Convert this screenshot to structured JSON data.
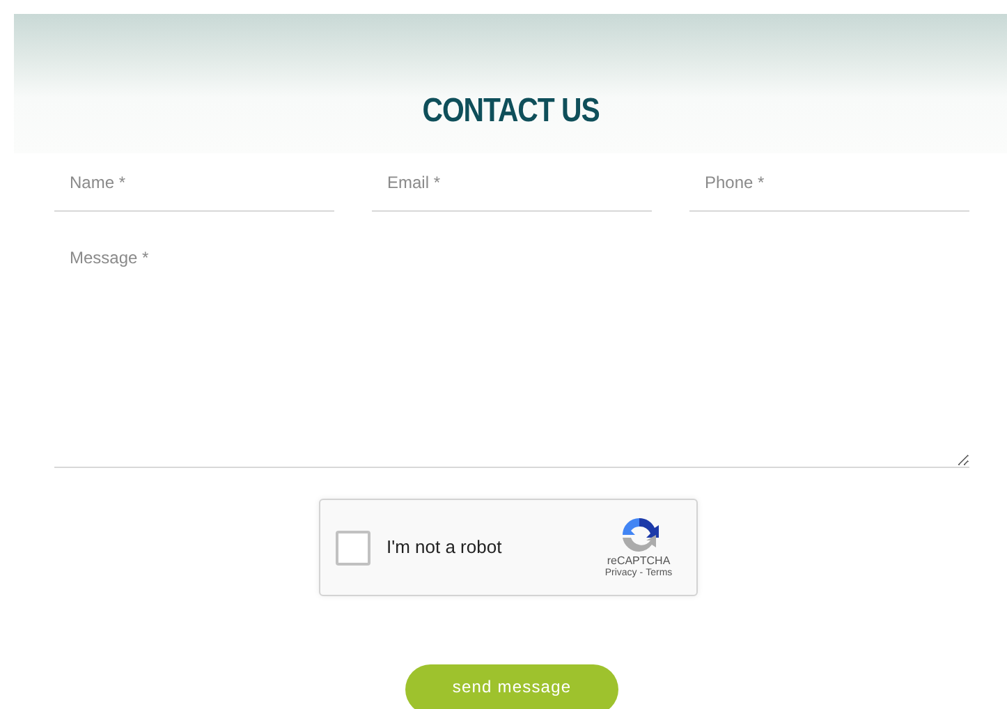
{
  "heading": "CONTACT US",
  "fields": [
    {
      "placeholder": "Name *"
    },
    {
      "placeholder": "Email *"
    },
    {
      "placeholder": "Phone *"
    }
  ],
  "message": {
    "placeholder": "Message *"
  },
  "captcha": {
    "label": "I'm not a robot",
    "checked": false,
    "brand": "reCAPTCHA",
    "privacy": "Privacy",
    "separator": "-",
    "terms": "Terms"
  },
  "submit": "send message"
}
